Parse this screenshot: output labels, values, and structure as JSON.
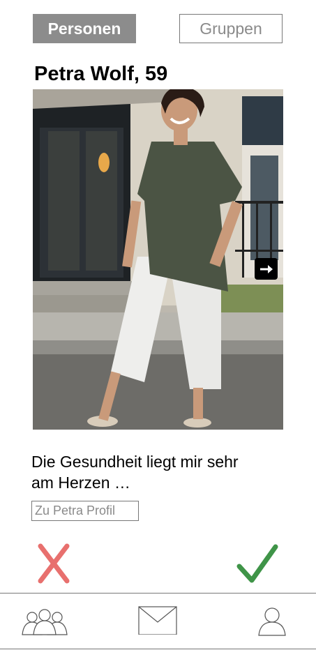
{
  "tabs": {
    "people_label": "Personen",
    "groups_label": "Gruppen",
    "active": "people"
  },
  "profile": {
    "name_age": "Petra Wolf, 59",
    "bio": "Die Gesundheit liegt mir sehr am Herzen …",
    "profile_link_label": "Zu Petra Profil"
  },
  "icons": {
    "next_photo": "arrow-right-icon",
    "dislike": "x-mark-icon",
    "like": "checkmark-icon",
    "nav_groups": "people-group-icon",
    "nav_messages": "envelope-icon",
    "nav_profile": "user-icon"
  },
  "colors": {
    "active_tab": "#8c8c8c",
    "dislike": "#e8706e",
    "like": "#3f9448",
    "icon_outline": "#555555"
  }
}
